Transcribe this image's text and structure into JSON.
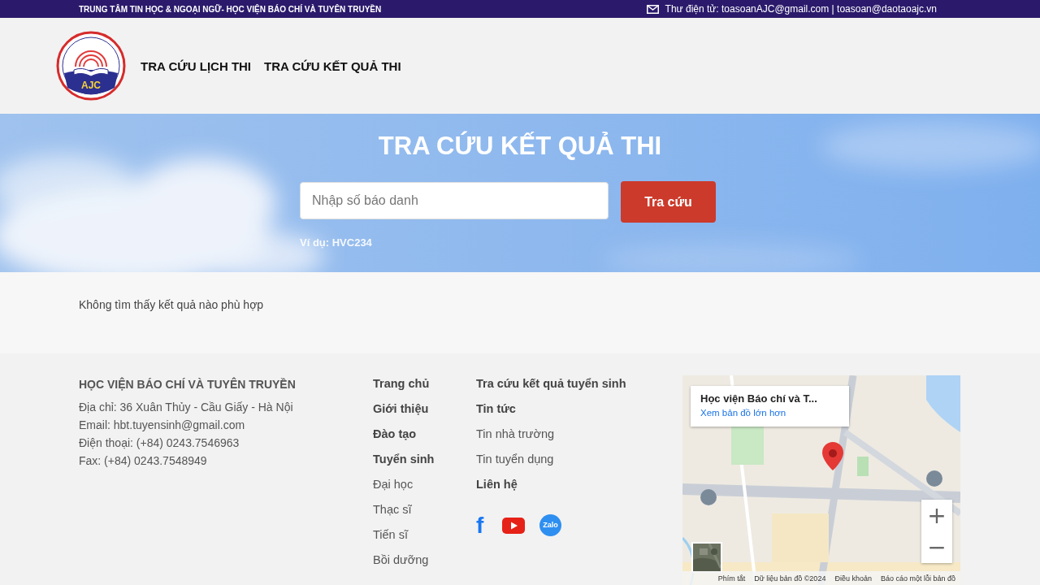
{
  "top_bar": {
    "title": "TRUNG TÂM TIN HỌC & NGOẠI NGỮ- HỌC VIỆN BÁO CHÍ VÀ TUYÊN TRUYỀN",
    "email_label": "Thư điện tử: toasoanAJC@gmail.com | toasoan@daotaoajc.vn"
  },
  "header": {
    "logo_text": "AJC",
    "nav": [
      {
        "label": "TRA CỨU LỊCH THI"
      },
      {
        "label": "TRA CỨU KẾT QUẢ THI"
      }
    ]
  },
  "hero": {
    "title": "TRA CỨU KẾT QUẢ THI",
    "search": {
      "placeholder": "Nhập số báo danh"
    },
    "button": "Tra cứu",
    "example": "Ví dụ: HVC234"
  },
  "result": {
    "message": "Không tìm thấy kết quả nào phù hợp"
  },
  "footer": {
    "org_name": "HỌC VIỆN BÁO CHÍ VÀ TUYÊN TRUYỀN",
    "contact": [
      "Địa chỉ: 36 Xuân Thủy - Cầu Giấy - Hà Nội",
      "Email: hbt.tuyensinh@gmail.com",
      "Điện thoại: (+84) 0243.7546963",
      "Fax: (+84) 0243.7548949"
    ],
    "links_1": [
      {
        "label": "Trang chủ",
        "bold": true
      },
      {
        "label": "Giới thiệu",
        "bold": true
      },
      {
        "label": "Đào tạo",
        "bold": true
      },
      {
        "label": "Tuyển sinh",
        "bold": true
      },
      {
        "label": "Đại học",
        "bold": false
      },
      {
        "label": "Thạc sĩ",
        "bold": false
      },
      {
        "label": "Tiến sĩ",
        "bold": false
      },
      {
        "label": "Bồi dưỡng",
        "bold": false
      }
    ],
    "links_2": [
      {
        "label": "Tra cứu kết quả tuyển sinh",
        "bold": true
      },
      {
        "label": "Tin tức",
        "bold": true
      },
      {
        "label": "Tin nhà trường",
        "bold": false
      },
      {
        "label": "Tin tuyển dụng",
        "bold": false
      },
      {
        "label": "Liên hệ",
        "bold": true
      }
    ],
    "social": [
      {
        "kind": "facebook",
        "glyph": "f"
      },
      {
        "kind": "youtube"
      },
      {
        "kind": "zalo",
        "glyph": "Zalo"
      }
    ],
    "map": {
      "kind": "picture",
      "place_title": "Học viện Báo chí và T...",
      "larger_map_link": "Xem bản đồ lớn hơn",
      "zoom_in": "+",
      "zoom_out": "−",
      "attribution": [
        "Phím tắt",
        "Dữ liệu bản đồ ©2024",
        "Điều khoản",
        "Báo cáo một lỗi bản đồ"
      ]
    }
  }
}
